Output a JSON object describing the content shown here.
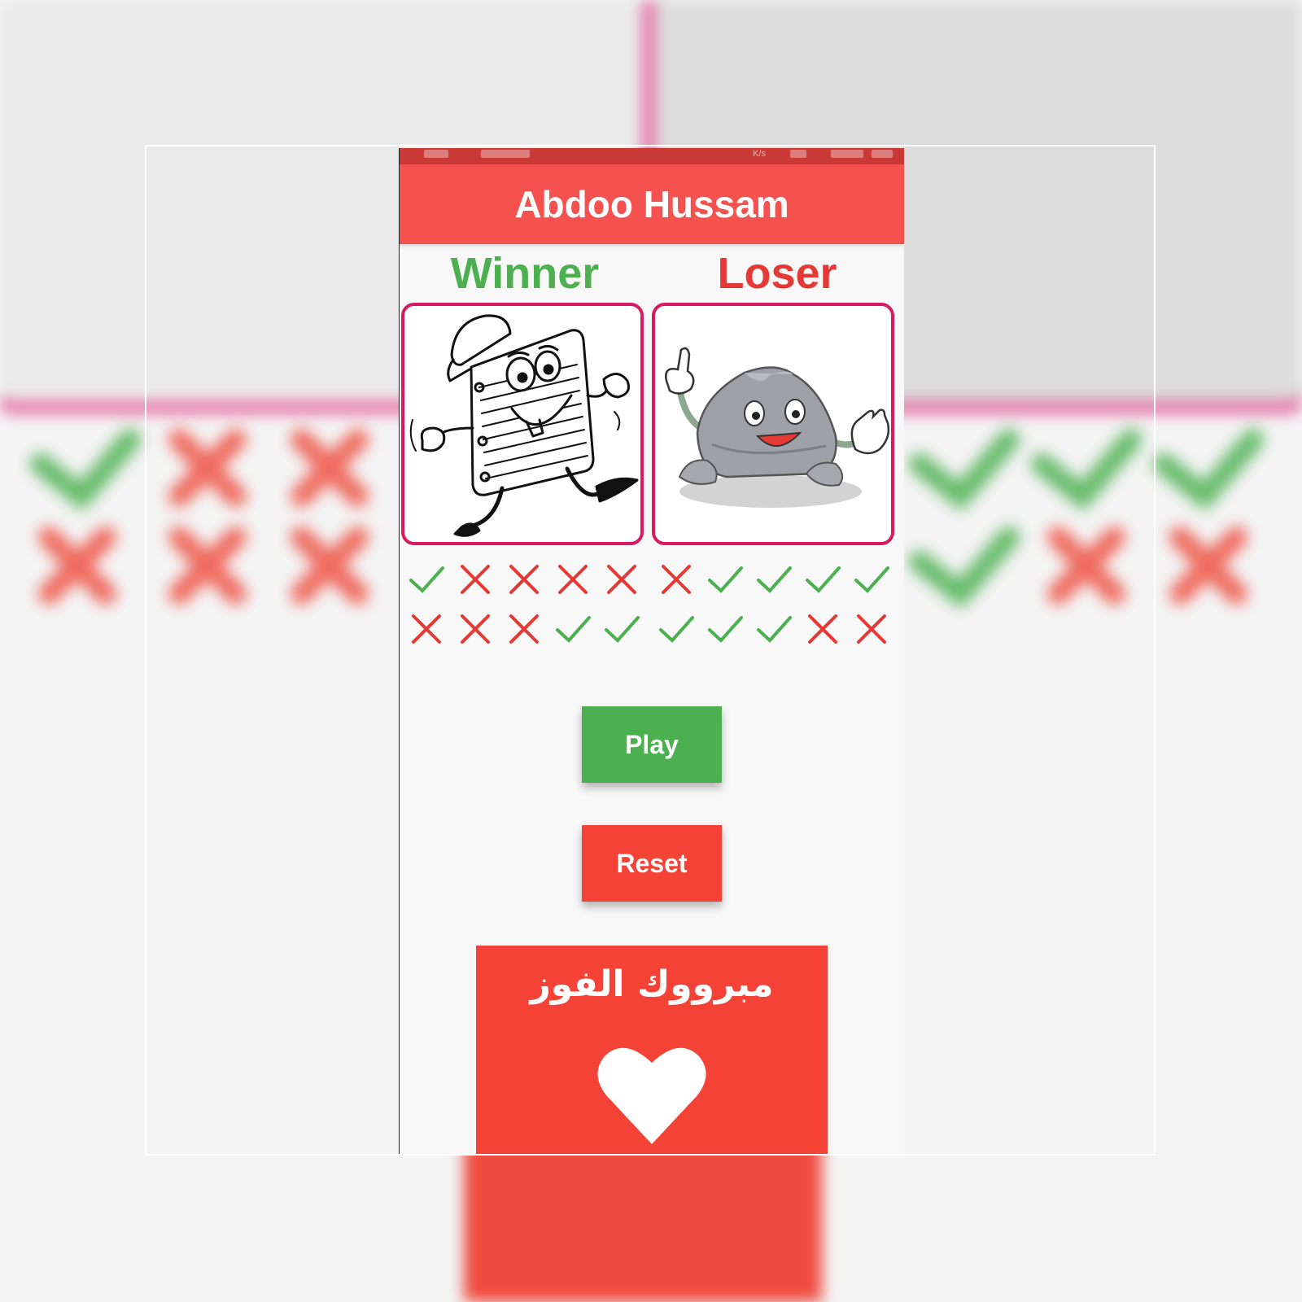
{
  "app": {
    "title": "Abdoo Hussam",
    "status_bar": {
      "speed_unit": "K/s"
    }
  },
  "players": {
    "winner_label": "Winner",
    "loser_label": "Loser",
    "winner_image": "notebook-character",
    "loser_image": "rock-character"
  },
  "results": {
    "left_grid": [
      [
        "check",
        "cross",
        "cross",
        "cross",
        "cross"
      ],
      [
        "cross",
        "cross",
        "cross",
        "check",
        "check"
      ]
    ],
    "right_grid": [
      [
        "cross",
        "check",
        "check",
        "check",
        "check"
      ],
      [
        "check",
        "check",
        "check",
        "cross",
        "cross"
      ]
    ]
  },
  "buttons": {
    "play_label": "Play",
    "reset_label": "Reset"
  },
  "banner": {
    "text": "مبرووك الفوز",
    "icon": "heart-icon"
  },
  "colors": {
    "app_bar": "#f4514f",
    "status_bar": "#c93a36",
    "winner": "#4caf50",
    "loser": "#e53935",
    "check": "#4caf50",
    "cross": "#e53935",
    "card_border": "#d81b60",
    "play": "#4caf50",
    "reset": "#f44336",
    "banner": "#f44336"
  }
}
